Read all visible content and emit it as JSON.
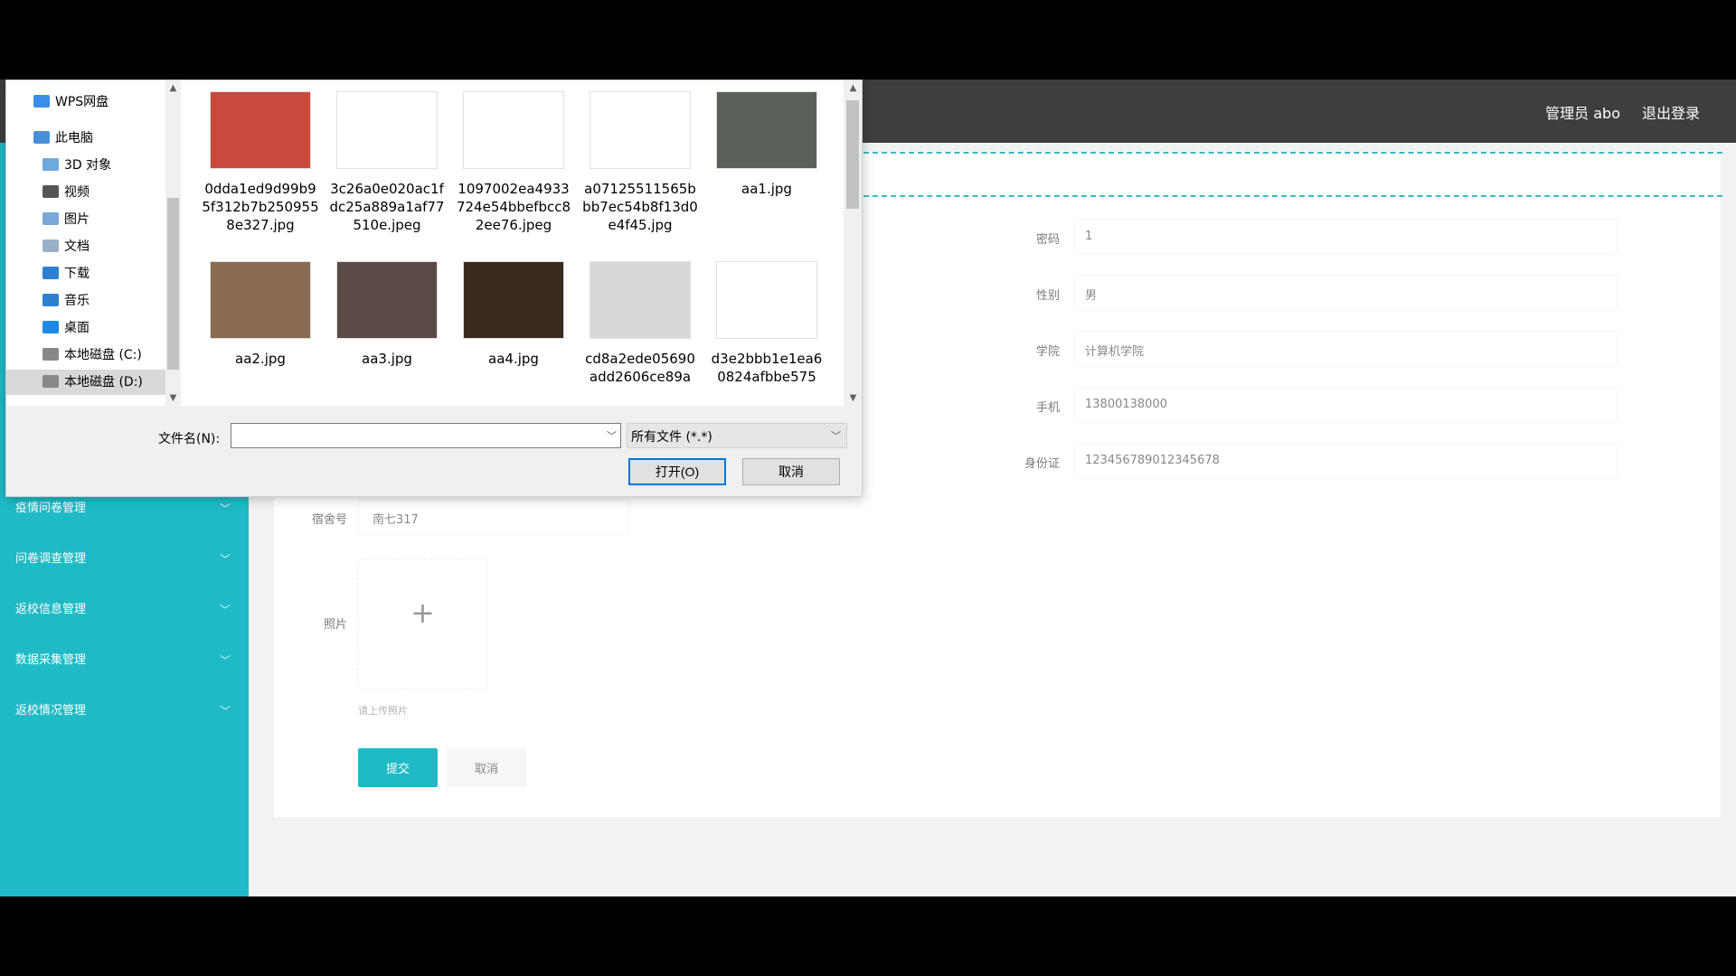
{
  "app": {
    "user_label": "管理员 abo",
    "logout": "退出登录"
  },
  "sidebar": {
    "items": [
      {
        "label": "疫情问卷管理"
      },
      {
        "label": "问卷调查管理"
      },
      {
        "label": "返校信息管理"
      },
      {
        "label": "数据采集管理"
      },
      {
        "label": "返校情况管理"
      }
    ]
  },
  "form": {
    "password": {
      "label": "密码",
      "value": "1"
    },
    "gender": {
      "label": "性别",
      "value": "男"
    },
    "college": {
      "label": "学院",
      "value": "计算机学院"
    },
    "phone": {
      "label": "手机",
      "value": "13800138000"
    },
    "id_card": {
      "label": "身份证",
      "value": "123456789012345678"
    },
    "dorm": {
      "label": "宿舍号",
      "value": "南七317"
    },
    "photo": {
      "label": "照片"
    },
    "photo_hint": "请上传照片",
    "submit": "提交",
    "cancel": "取消"
  },
  "dialog": {
    "nav": [
      {
        "label": "WPS网盘",
        "icon": "cloud-icon",
        "color": "#3a8ee6"
      },
      {
        "label": "此电脑",
        "icon": "computer-icon",
        "color": "#4a90d9"
      },
      {
        "label": "3D 对象",
        "icon": "3d-objects-icon",
        "color": "#6fa8dc"
      },
      {
        "label": "视频",
        "icon": "video-icon",
        "color": "#555555"
      },
      {
        "label": "图片",
        "icon": "pictures-icon",
        "color": "#7aa7d6"
      },
      {
        "label": "文档",
        "icon": "documents-icon",
        "color": "#9ab0c8"
      },
      {
        "label": "下载",
        "icon": "download-icon",
        "color": "#2f7fd1"
      },
      {
        "label": "音乐",
        "icon": "music-icon",
        "color": "#2f7fd1"
      },
      {
        "label": "桌面",
        "icon": "desktop-icon",
        "color": "#1e88e5"
      },
      {
        "label": "本地磁盘 (C:)",
        "icon": "drive-c-icon",
        "color": "#888888"
      },
      {
        "label": "本地磁盘 (D:)",
        "icon": "drive-d-icon",
        "color": "#888888"
      }
    ],
    "files": [
      {
        "name": "0dda1ed9d99b95f312b7b2509558e327.jpg",
        "color": "#c94a3d"
      },
      {
        "name": "3c26a0e020ac1fdc25a889a1af77510e.jpeg",
        "color": "#ffffff"
      },
      {
        "name": "1097002ea4933724e54bbefbcc82ee76.jpeg",
        "color": "#ffffff"
      },
      {
        "name": "a07125511565bbb7ec54b8f13d0e4f45.jpg",
        "color": "#ffffff"
      },
      {
        "name": "aa1.jpg",
        "color": "#5a5f57"
      },
      {
        "name": "aa2.jpg",
        "color": "#8a6a50"
      },
      {
        "name": "aa3.jpg",
        "color": "#5a4a48"
      },
      {
        "name": "aa4.jpg",
        "color": "#3a2a20"
      },
      {
        "name": "cd8a2ede05690add2606ce89a",
        "color": "#d8d8d8"
      },
      {
        "name": "d3e2bbb1e1ea60824afbbe575",
        "color": "#ffffff"
      }
    ],
    "filename_label": "文件名(N):",
    "filename_value": "",
    "filetype": "所有文件 (*.*)",
    "open": "打开(O)",
    "cancel": "取消"
  }
}
